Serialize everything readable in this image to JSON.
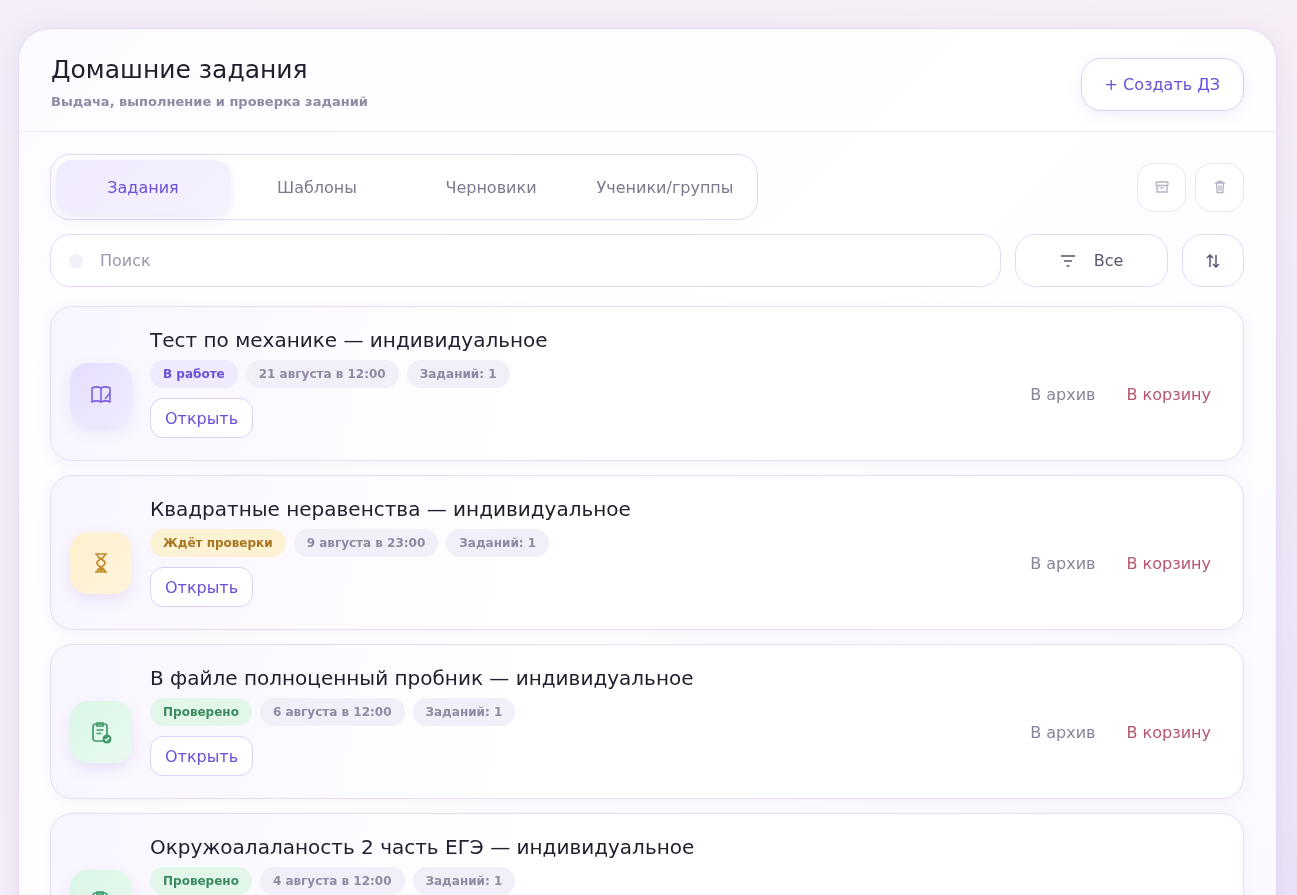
{
  "header": {
    "title": "Домашние задания",
    "subtitle": "Выдача, выполнение и проверка заданий",
    "create_button": "+ Создать ДЗ"
  },
  "tabs": [
    {
      "label": "Задания",
      "selected": true
    },
    {
      "label": "Шаблоны",
      "selected": false
    },
    {
      "label": "Черновики",
      "selected": false
    },
    {
      "label": "Ученики/группы",
      "selected": false
    }
  ],
  "search": {
    "placeholder": "Поиск"
  },
  "filter": {
    "label": "Все"
  },
  "assignments": [
    {
      "title": "Тест по механике — индивидуальное",
      "status": {
        "label": "В работе",
        "kind": "in_progress"
      },
      "due": "21 августа в 12:00",
      "count": "Заданий: 1",
      "open": "Открыть",
      "archive": "В архив",
      "trash": "В корзину"
    },
    {
      "title": "Квадратные неравенства — индивидуальное",
      "status": {
        "label": "Ждёт проверки",
        "kind": "pending"
      },
      "due": "9 августа в 23:00",
      "count": "Заданий: 1",
      "open": "Открыть",
      "archive": "В архив",
      "trash": "В корзину"
    },
    {
      "title": "В файле полноценный пробник — индивидуальное",
      "status": {
        "label": "Проверено",
        "kind": "checked"
      },
      "due": "6 августа в 12:00",
      "count": "Заданий: 1",
      "open": "Открыть",
      "archive": "В архив",
      "trash": "В корзину"
    },
    {
      "title": "Окружоалаланость 2 часть ЕГЭ — индивидуальное",
      "status": {
        "label": "Проверено",
        "kind": "checked"
      },
      "due": "4 августа в 12:00",
      "count": "Заданий: 1"
    }
  ]
}
